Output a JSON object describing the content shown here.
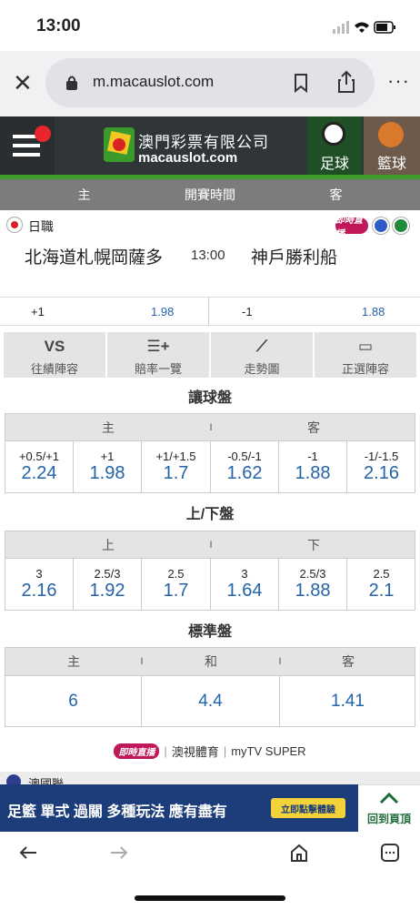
{
  "status": {
    "time": "13:00"
  },
  "browser": {
    "url": "m.macauslot.com"
  },
  "banner": {
    "logo_cn": "澳門彩票有限公司",
    "logo_en": "macauslot.com",
    "tab_football": "足球",
    "tab_basketball": "籃球"
  },
  "header": {
    "home": "主",
    "start_time": "開賽時間",
    "away": "客"
  },
  "match": {
    "league": "日職",
    "live_badge": "即時直播",
    "home_team": "北海道札幌岡薩多",
    "time": "13:00",
    "away_team": "神戶勝利船"
  },
  "handicap_line": {
    "home_hcp": "+1",
    "home_odds": "1.98",
    "away_hcp": "-1",
    "away_odds": "1.88"
  },
  "tools": [
    {
      "label": "往績陣容",
      "icon": "vs-icon"
    },
    {
      "label": "賠率一覽",
      "icon": "list-icon"
    },
    {
      "label": "走勢圖",
      "icon": "trend-icon"
    },
    {
      "label": "正選陣容",
      "icon": "lineup-icon"
    }
  ],
  "handicap": {
    "title": "讓球盤",
    "home": "主",
    "sep": "I",
    "away": "客",
    "cells": [
      {
        "line": "+0.5/+1",
        "odds": "2.24"
      },
      {
        "line": "+1",
        "odds": "1.98"
      },
      {
        "line": "+1/+1.5",
        "odds": "1.7"
      },
      {
        "line": "-0.5/-1",
        "odds": "1.62"
      },
      {
        "line": "-1",
        "odds": "1.88"
      },
      {
        "line": "-1/-1.5",
        "odds": "2.16"
      }
    ]
  },
  "overunder": {
    "title": "上/下盤",
    "over": "上",
    "sep": "I",
    "under": "下",
    "cells": [
      {
        "line": "3",
        "odds": "2.16"
      },
      {
        "line": "2.5/3",
        "odds": "1.92"
      },
      {
        "line": "2.5",
        "odds": "1.7"
      },
      {
        "line": "3",
        "odds": "1.64"
      },
      {
        "line": "2.5/3",
        "odds": "1.88"
      },
      {
        "line": "2.5",
        "odds": "2.1"
      }
    ]
  },
  "standard": {
    "title": "標準盤",
    "home": "主",
    "sep1": "I",
    "draw": "和",
    "sep2": "I",
    "away": "客",
    "home_odds": "6",
    "draw_odds": "4.4",
    "away_odds": "1.41"
  },
  "broadcast": {
    "badge": "即時直播",
    "ch1": "澳視體育",
    "ch2": "myTV SUPER"
  },
  "ad": {
    "text": "足籃 單式 過關  多種玩法 應有盡有",
    "button": "立即點擊體驗",
    "next_league": "澳國聯"
  },
  "back_to_top": "回到頁頂"
}
